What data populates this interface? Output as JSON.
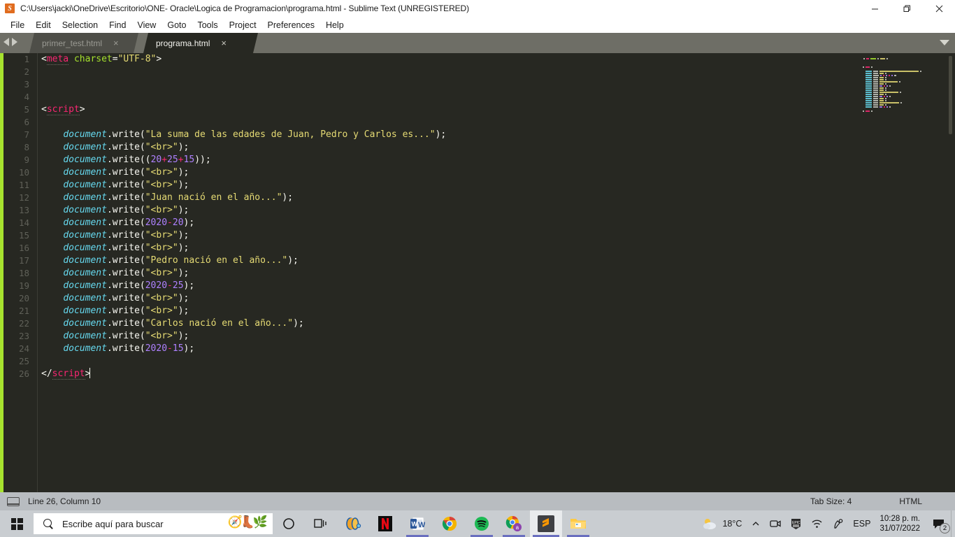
{
  "window": {
    "title": "C:\\Users\\jacki\\OneDrive\\Escritorio\\ONE- Oracle\\Logica de Programacion\\programa.html - Sublime Text (UNREGISTERED)",
    "logo_glyph": "S",
    "minimize_label": "Minimize",
    "maximize_label": "Restore",
    "close_label": "Close"
  },
  "menu": {
    "items": [
      {
        "label": "File"
      },
      {
        "label": "Edit"
      },
      {
        "label": "Selection"
      },
      {
        "label": "Find"
      },
      {
        "label": "View"
      },
      {
        "label": "Goto"
      },
      {
        "label": "Tools"
      },
      {
        "label": "Project"
      },
      {
        "label": "Preferences"
      },
      {
        "label": "Help"
      }
    ]
  },
  "tabs": {
    "items": [
      {
        "label": "primer_test.html",
        "close": "×",
        "active": false
      },
      {
        "label": "programa.html",
        "close": "×",
        "active": true
      }
    ]
  },
  "editor": {
    "lines": [
      {
        "n": "1",
        "tokens": [
          {
            "t": "<",
            "c": "punc"
          },
          {
            "t": "meta",
            "c": "tag"
          },
          {
            "t": " ",
            "c": "plain"
          },
          {
            "t": "charset",
            "c": "attr"
          },
          {
            "t": "=",
            "c": "punc"
          },
          {
            "t": "\"UTF-8\"",
            "c": "str"
          },
          {
            "t": ">",
            "c": "punc"
          }
        ]
      },
      {
        "n": "2",
        "tokens": []
      },
      {
        "n": "3",
        "tokens": []
      },
      {
        "n": "4",
        "tokens": []
      },
      {
        "n": "5",
        "tokens": [
          {
            "t": "<",
            "c": "punc"
          },
          {
            "t": "script",
            "c": "tag"
          },
          {
            "t": ">",
            "c": "punc"
          }
        ]
      },
      {
        "n": "6",
        "tokens": []
      },
      {
        "n": "7",
        "tokens": [
          {
            "t": "    ",
            "c": "plain"
          },
          {
            "t": "document",
            "c": "obj"
          },
          {
            "t": ".write(",
            "c": "fn"
          },
          {
            "t": "\"La suma de las edades de Juan, Pedro y Carlos es...\"",
            "c": "str"
          },
          {
            "t": ");",
            "c": "fn"
          }
        ]
      },
      {
        "n": "8",
        "tokens": [
          {
            "t": "    ",
            "c": "plain"
          },
          {
            "t": "document",
            "c": "obj"
          },
          {
            "t": ".write(",
            "c": "fn"
          },
          {
            "t": "\"<br>\"",
            "c": "str"
          },
          {
            "t": ");",
            "c": "fn"
          }
        ]
      },
      {
        "n": "9",
        "tokens": [
          {
            "t": "    ",
            "c": "plain"
          },
          {
            "t": "document",
            "c": "obj"
          },
          {
            "t": ".write((",
            "c": "fn"
          },
          {
            "t": "20",
            "c": "num"
          },
          {
            "t": "+",
            "c": "op"
          },
          {
            "t": "25",
            "c": "num"
          },
          {
            "t": "+",
            "c": "op"
          },
          {
            "t": "15",
            "c": "num"
          },
          {
            "t": "));",
            "c": "fn"
          }
        ]
      },
      {
        "n": "10",
        "tokens": [
          {
            "t": "    ",
            "c": "plain"
          },
          {
            "t": "document",
            "c": "obj"
          },
          {
            "t": ".write(",
            "c": "fn"
          },
          {
            "t": "\"<br>\"",
            "c": "str"
          },
          {
            "t": ");",
            "c": "fn"
          }
        ]
      },
      {
        "n": "11",
        "tokens": [
          {
            "t": "    ",
            "c": "plain"
          },
          {
            "t": "document",
            "c": "obj"
          },
          {
            "t": ".write(",
            "c": "fn"
          },
          {
            "t": "\"<br>\"",
            "c": "str"
          },
          {
            "t": ");",
            "c": "fn"
          }
        ]
      },
      {
        "n": "12",
        "tokens": [
          {
            "t": "    ",
            "c": "plain"
          },
          {
            "t": "document",
            "c": "obj"
          },
          {
            "t": ".write(",
            "c": "fn"
          },
          {
            "t": "\"Juan nació en el año...\"",
            "c": "str"
          },
          {
            "t": ");",
            "c": "fn"
          }
        ]
      },
      {
        "n": "13",
        "tokens": [
          {
            "t": "    ",
            "c": "plain"
          },
          {
            "t": "document",
            "c": "obj"
          },
          {
            "t": ".write(",
            "c": "fn"
          },
          {
            "t": "\"<br>\"",
            "c": "str"
          },
          {
            "t": ");",
            "c": "fn"
          }
        ]
      },
      {
        "n": "14",
        "tokens": [
          {
            "t": "    ",
            "c": "plain"
          },
          {
            "t": "document",
            "c": "obj"
          },
          {
            "t": ".write(",
            "c": "fn"
          },
          {
            "t": "2020",
            "c": "num"
          },
          {
            "t": "-",
            "c": "op"
          },
          {
            "t": "20",
            "c": "num"
          },
          {
            "t": ");",
            "c": "fn"
          }
        ]
      },
      {
        "n": "15",
        "tokens": [
          {
            "t": "    ",
            "c": "plain"
          },
          {
            "t": "document",
            "c": "obj"
          },
          {
            "t": ".write(",
            "c": "fn"
          },
          {
            "t": "\"<br>\"",
            "c": "str"
          },
          {
            "t": ");",
            "c": "fn"
          }
        ]
      },
      {
        "n": "16",
        "tokens": [
          {
            "t": "    ",
            "c": "plain"
          },
          {
            "t": "document",
            "c": "obj"
          },
          {
            "t": ".write(",
            "c": "fn"
          },
          {
            "t": "\"<br>\"",
            "c": "str"
          },
          {
            "t": ");",
            "c": "fn"
          }
        ]
      },
      {
        "n": "17",
        "tokens": [
          {
            "t": "    ",
            "c": "plain"
          },
          {
            "t": "document",
            "c": "obj"
          },
          {
            "t": ".write(",
            "c": "fn"
          },
          {
            "t": "\"Pedro nació en el año...\"",
            "c": "str"
          },
          {
            "t": ");",
            "c": "fn"
          }
        ]
      },
      {
        "n": "18",
        "tokens": [
          {
            "t": "    ",
            "c": "plain"
          },
          {
            "t": "document",
            "c": "obj"
          },
          {
            "t": ".write(",
            "c": "fn"
          },
          {
            "t": "\"<br>\"",
            "c": "str"
          },
          {
            "t": ");",
            "c": "fn"
          }
        ]
      },
      {
        "n": "19",
        "tokens": [
          {
            "t": "    ",
            "c": "plain"
          },
          {
            "t": "document",
            "c": "obj"
          },
          {
            "t": ".write(",
            "c": "fn"
          },
          {
            "t": "2020",
            "c": "num"
          },
          {
            "t": "-",
            "c": "op"
          },
          {
            "t": "25",
            "c": "num"
          },
          {
            "t": ");",
            "c": "fn"
          }
        ]
      },
      {
        "n": "20",
        "tokens": [
          {
            "t": "    ",
            "c": "plain"
          },
          {
            "t": "document",
            "c": "obj"
          },
          {
            "t": ".write(",
            "c": "fn"
          },
          {
            "t": "\"<br>\"",
            "c": "str"
          },
          {
            "t": ");",
            "c": "fn"
          }
        ]
      },
      {
        "n": "21",
        "tokens": [
          {
            "t": "    ",
            "c": "plain"
          },
          {
            "t": "document",
            "c": "obj"
          },
          {
            "t": ".write(",
            "c": "fn"
          },
          {
            "t": "\"<br>\"",
            "c": "str"
          },
          {
            "t": ");",
            "c": "fn"
          }
        ]
      },
      {
        "n": "22",
        "tokens": [
          {
            "t": "    ",
            "c": "plain"
          },
          {
            "t": "document",
            "c": "obj"
          },
          {
            "t": ".write(",
            "c": "fn"
          },
          {
            "t": "\"Carlos nació en el año...\"",
            "c": "str"
          },
          {
            "t": ");",
            "c": "fn"
          }
        ]
      },
      {
        "n": "23",
        "tokens": [
          {
            "t": "    ",
            "c": "plain"
          },
          {
            "t": "document",
            "c": "obj"
          },
          {
            "t": ".write(",
            "c": "fn"
          },
          {
            "t": "\"<br>\"",
            "c": "str"
          },
          {
            "t": ");",
            "c": "fn"
          }
        ]
      },
      {
        "n": "24",
        "tokens": [
          {
            "t": "    ",
            "c": "plain"
          },
          {
            "t": "document",
            "c": "obj"
          },
          {
            "t": ".write(",
            "c": "fn"
          },
          {
            "t": "2020",
            "c": "num"
          },
          {
            "t": "-",
            "c": "op"
          },
          {
            "t": "15",
            "c": "num"
          },
          {
            "t": ");",
            "c": "fn"
          }
        ]
      },
      {
        "n": "25",
        "tokens": []
      },
      {
        "n": "26",
        "tokens": [
          {
            "t": "</",
            "c": "punc"
          },
          {
            "t": "script",
            "c": "tag"
          },
          {
            "t": ">",
            "c": "punc"
          }
        ],
        "cursor": true
      }
    ],
    "colors": {
      "background": "#272822",
      "gutter_text": "#5f6058",
      "tag": "#f92672",
      "attribute": "#a6e22e",
      "string": "#e6db74",
      "object": "#66d9ef",
      "number": "#ae81ff",
      "operator": "#f92672",
      "plain": "#f8f8f2",
      "accent_strip": "#a6e22e"
    }
  },
  "statusbar": {
    "cursor_position": "Line 26, Column 10",
    "tab_size": "Tab Size: 4",
    "syntax": "HTML"
  },
  "taskbar": {
    "search_placeholder": "Escribe aquí para buscar",
    "items": [
      {
        "name": "cortana",
        "label": "Cortana"
      },
      {
        "name": "task-view",
        "label": "Vista de tareas"
      },
      {
        "name": "media-player",
        "label": "Reproductor"
      },
      {
        "name": "netflix",
        "label": "Netflix"
      },
      {
        "name": "word",
        "label": "Word"
      },
      {
        "name": "chrome",
        "label": "Google Chrome"
      },
      {
        "name": "spotify",
        "label": "Spotify"
      },
      {
        "name": "chrome-profile",
        "label": "Chrome (perfil a)"
      },
      {
        "name": "sublime-text",
        "label": "Sublime Text"
      },
      {
        "name": "file-explorer",
        "label": "Explorador de archivos"
      }
    ],
    "tray": {
      "temperature": "18°C",
      "language": "ESP",
      "time": "10:28 p. m.",
      "date": "31/07/2022",
      "notification_count": "2"
    }
  }
}
